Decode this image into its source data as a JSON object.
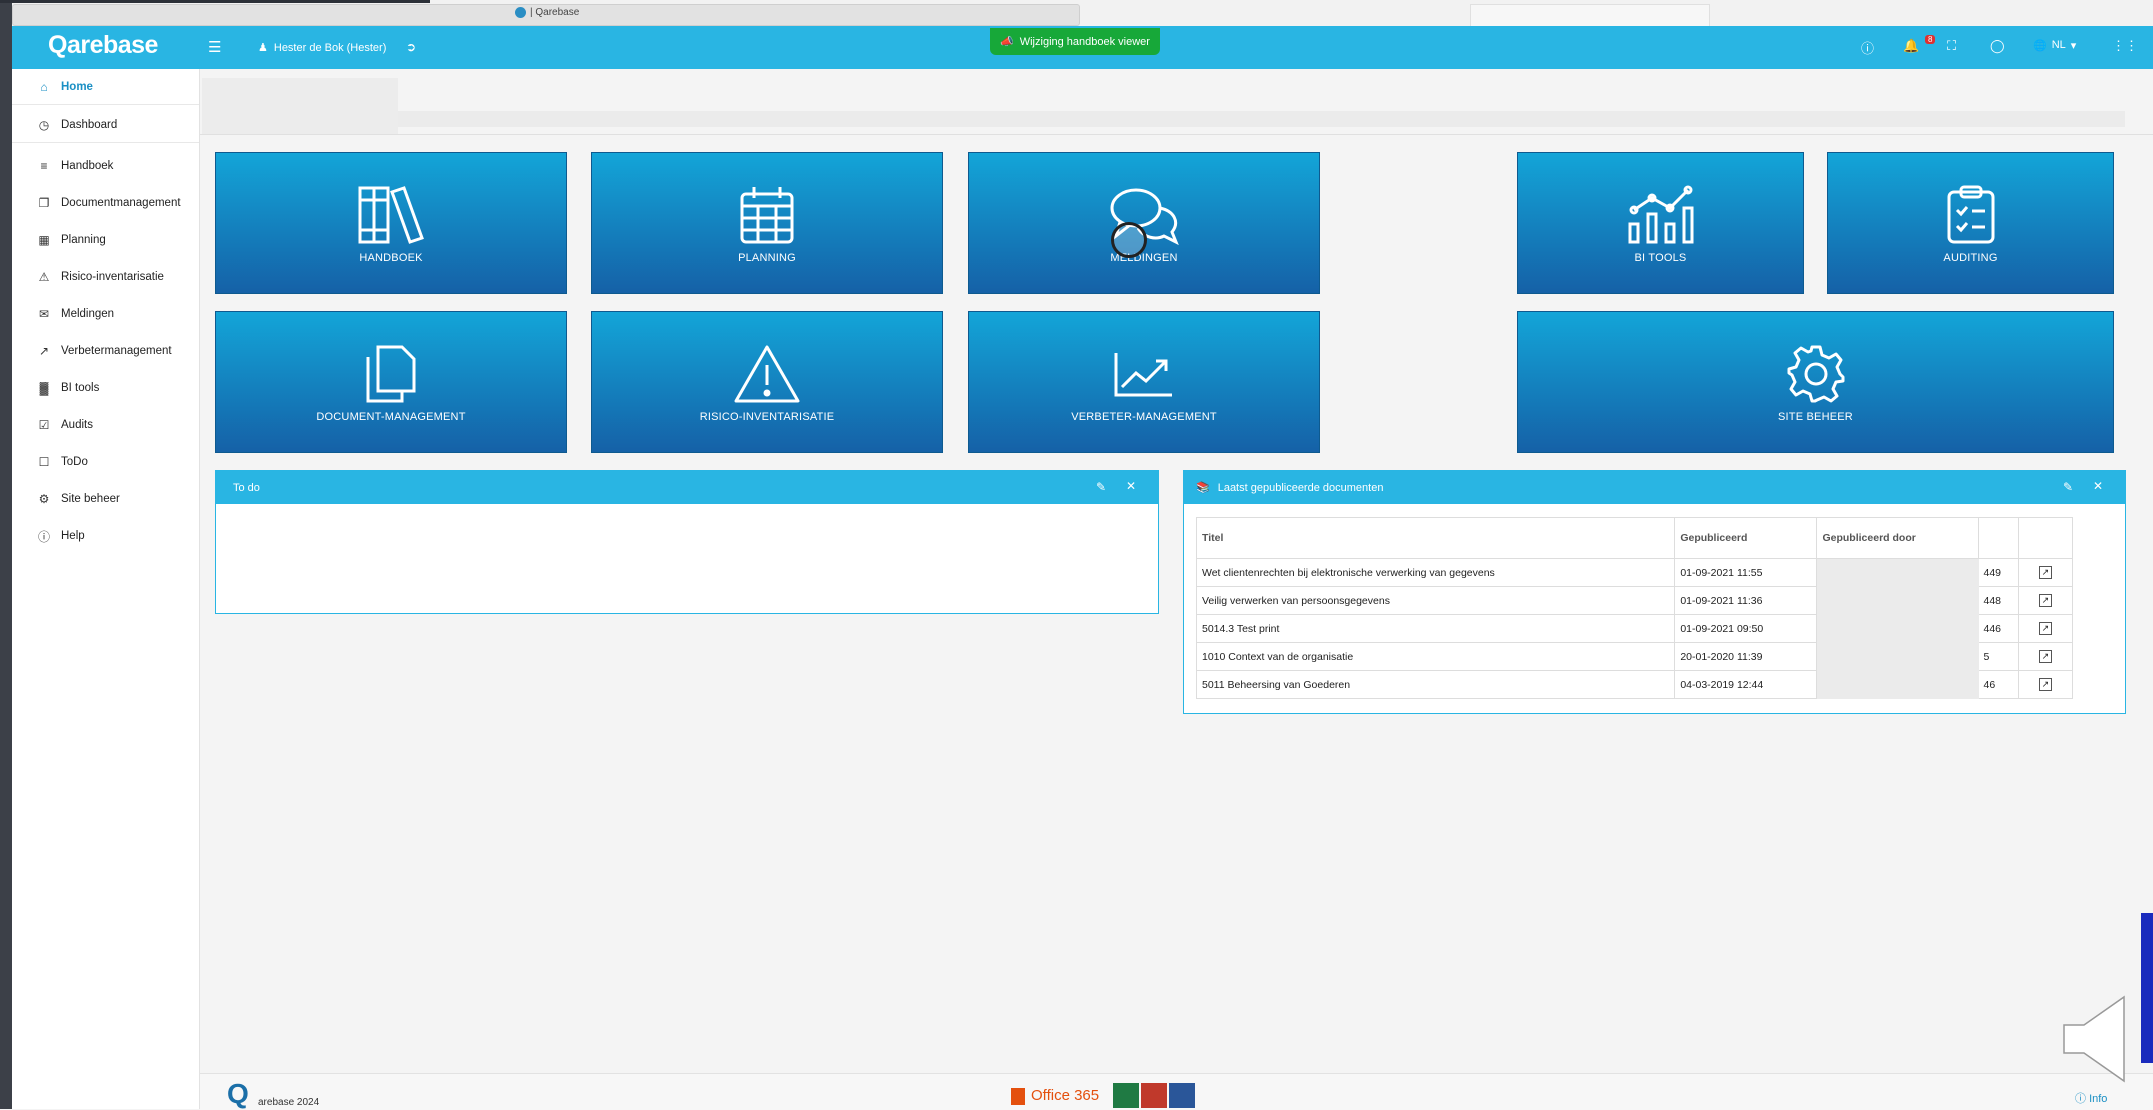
{
  "browser": {
    "tab_title": "| Qarebase"
  },
  "topbar": {
    "logo": "Qarebase",
    "user_name": "Hester de Bok (Hester)",
    "banner": "Wijziging handboek viewer",
    "notification_count": "8",
    "language": "NL"
  },
  "sidebar": {
    "items": [
      {
        "label": "Home",
        "icon": "home-icon"
      },
      {
        "label": "Dashboard",
        "icon": "dashboard-icon"
      },
      {
        "label": "Handboek",
        "icon": "books-icon"
      },
      {
        "label": "Documentmanagement",
        "icon": "documents-icon"
      },
      {
        "label": "Planning",
        "icon": "calendar-icon"
      },
      {
        "label": "Risico-inventarisatie",
        "icon": "warning-icon"
      },
      {
        "label": "Meldingen",
        "icon": "chat-icon"
      },
      {
        "label": "Verbetermanagement",
        "icon": "chart-line-icon"
      },
      {
        "label": "BI tools",
        "icon": "bar-chart-icon"
      },
      {
        "label": "Audits",
        "icon": "clipboard-icon"
      },
      {
        "label": "ToDo",
        "icon": "todo-icon"
      },
      {
        "label": "Site beheer",
        "icon": "gear-icon"
      },
      {
        "label": "Help",
        "icon": "help-icon"
      }
    ]
  },
  "tiles": {
    "handboek": "HANDBOEK",
    "planning": "PLANNING",
    "meldingen": "MELDINGEN",
    "bi_tools": "BI TOOLS",
    "auditing": "AUDITING",
    "document_management": "DOCUMENT-MANAGEMENT",
    "risico": "RISICO-INVENTARISATIE",
    "verbeter": "VERBETER-MANAGEMENT",
    "site_beheer": "SITE BEHEER"
  },
  "todo_panel": {
    "title": "To do"
  },
  "docs_panel": {
    "title": "Laatst gepubliceerde documenten",
    "columns": [
      "Titel",
      "Gepubliceerd",
      "Gepubliceerd door"
    ],
    "rows": [
      {
        "title": "Wet clientenrechten bij elektronische verwerking van gegevens",
        "date": "01-09-2021 11:55",
        "number": "449"
      },
      {
        "title": "Veilig verwerken van persoonsgegevens",
        "date": "01-09-2021 11:36",
        "number": "448"
      },
      {
        "title": "5014.3 Test print",
        "date": "01-09-2021 09:50",
        "number": "446"
      },
      {
        "title": "1010 Context van de organisatie",
        "date": "20-01-2020 11:39",
        "number": "5"
      },
      {
        "title": "5011 Beheersing van Goederen",
        "date": "04-03-2019 12:44",
        "number": "46"
      }
    ]
  },
  "footer": {
    "copyright": "arebase 2024",
    "office": "Office 365",
    "info": "Info"
  },
  "colors": {
    "accent": "#29b5e3",
    "tile_top": "#13a5d8",
    "tile_bottom": "#1561a7",
    "banner": "#17a839"
  }
}
